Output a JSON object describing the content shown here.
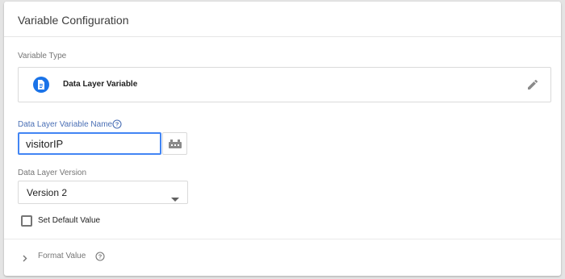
{
  "panel": {
    "title": "Variable Configuration"
  },
  "variable_type": {
    "section_label": "Variable Type",
    "selected_label": "Data Layer Variable",
    "icon": "data-layer-document-icon",
    "icon_color": "#1a73e8"
  },
  "name_field": {
    "label": "Data Layer Variable Name",
    "value": "visitorIP",
    "focus_color": "#4285f4"
  },
  "version": {
    "label": "Data Layer Version",
    "selected": "Version 2"
  },
  "default_value": {
    "label": "Set Default Value",
    "checked": false
  },
  "format_value": {
    "label": "Format Value"
  }
}
